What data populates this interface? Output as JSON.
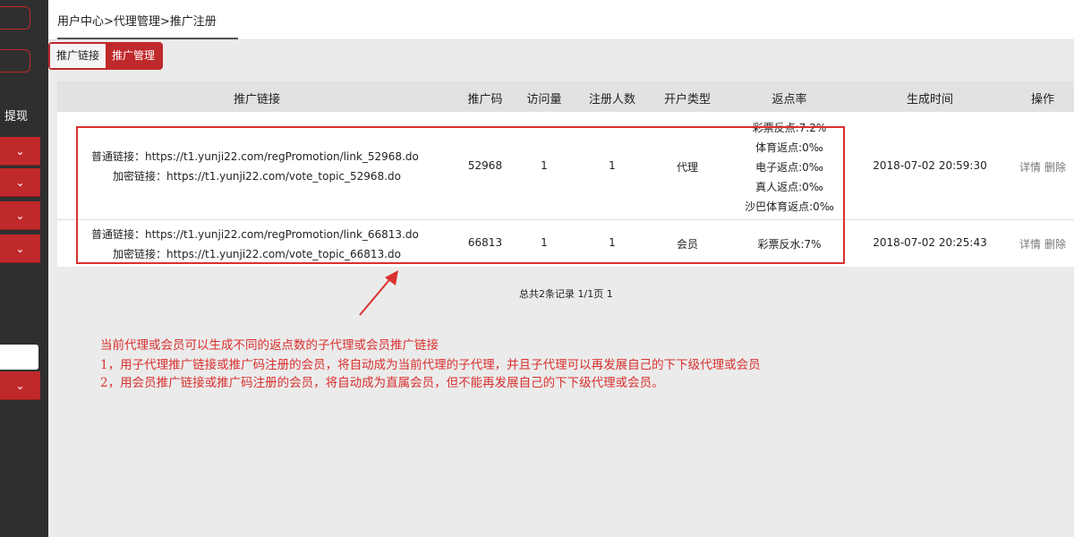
{
  "sidebar": {
    "label": "提现",
    "chevron": "⌄"
  },
  "header": {
    "breadcrumb": "用户中心>代理管理>推广注册"
  },
  "tabs": [
    "推广链接",
    "推广管理"
  ],
  "table": {
    "headers": [
      "推广链接",
      "推广码",
      "访问量",
      "注册人数",
      "开户类型",
      "返点率",
      "生成时间",
      "操作"
    ],
    "rows": [
      {
        "link1": "普通链接：https://t1.yunji22.com/regPromotion/link_52968.do",
        "link2": "加密链接：https://t1.yunji22.com/vote_topic_52968.do",
        "code": "52968",
        "visits": "1",
        "registrations": "1",
        "type": "代理",
        "rebate": [
          "彩票反点:7.2%",
          "体育返点:0‰",
          "电子返点:0‰",
          "真人返点:0‰",
          "沙巴体育返点:0‰"
        ],
        "time": "2018-07-02 20:59:30",
        "detail": "详情",
        "delete": "删除"
      },
      {
        "link1": "普通链接：https://t1.yunji22.com/regPromotion/link_66813.do",
        "link2": "加密链接：https://t1.yunji22.com/vote_topic_66813.do",
        "code": "66813",
        "visits": "1",
        "registrations": "1",
        "type": "会员",
        "rebate": [
          "彩票反水:7%"
        ],
        "time": "2018-07-02 20:25:43",
        "detail": "详情",
        "delete": "删除"
      }
    ]
  },
  "pager": "总共2条记录 1/1页 1",
  "notes": [
    "当前代理或会员可以生成不同的返点数的子代理或会员推广链接",
    "1，用子代理推广链接或推广码注册的会员，将自动成为当前代理的子代理，并且子代理可以再发展自己的下下级代理或会员",
    "2，用会员推广链接或推广码注册的会员，将自动成为直属会员，但不能再发展自己的下下级代理或会员。"
  ]
}
